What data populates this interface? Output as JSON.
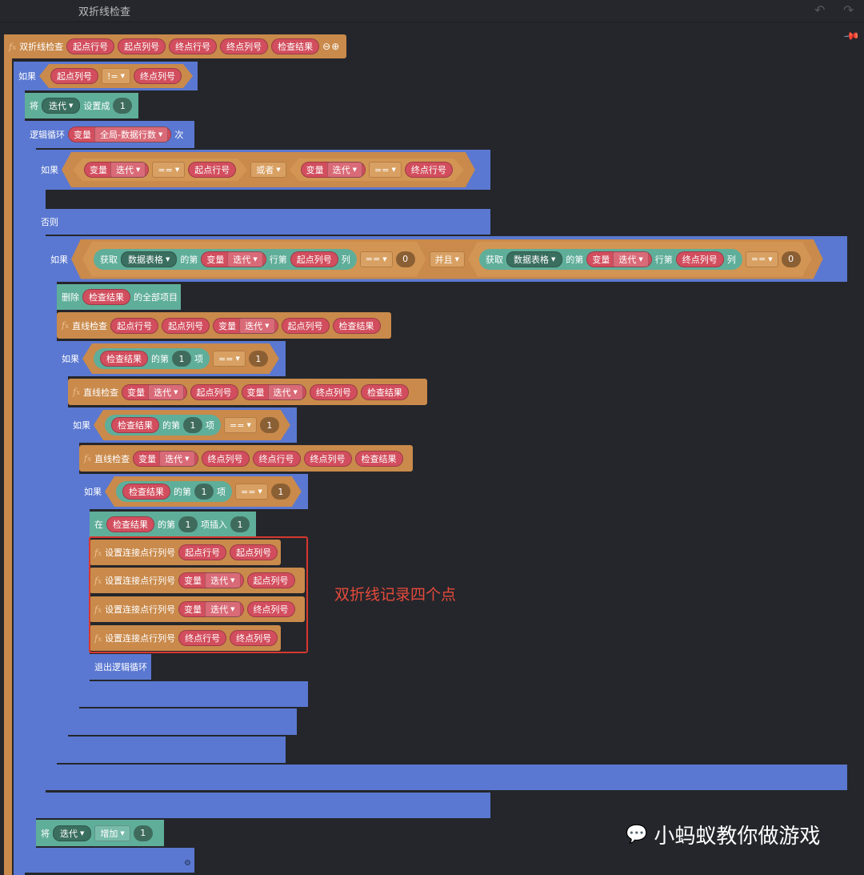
{
  "window": {
    "title": "双折线检查",
    "undo_icon": "undo-icon",
    "redo_icon": "redo-icon",
    "pin_icon": "pin-icon"
  },
  "func_def": {
    "fx": "f",
    "name": "双折线检查",
    "params": [
      "起点行号",
      "起点列号",
      "终点行号",
      "终点列号",
      "检查结果"
    ],
    "controls": "⊖⊕"
  },
  "blocks": {
    "if1": {
      "kw": "如果",
      "a": "起点列号",
      "op": "!=",
      "b": "终点列号"
    },
    "set1": {
      "kw": "将",
      "var": "迭代",
      "mid": "设置成",
      "val": "1"
    },
    "loop": {
      "kw": "逻辑循环",
      "var_kw": "变量",
      "var": "全局-数据行数",
      "tail": "次"
    },
    "if2": {
      "kw": "如果",
      "var_kw": "变量",
      "var": "迭代",
      "op": "==",
      "b": "起点行号",
      "or": "或者",
      "var_kw2": "变量",
      "var2": "迭代",
      "op2": "==",
      "b2": "终点行号"
    },
    "else": "否则",
    "if3": {
      "kw": "如果",
      "get": "获取",
      "table": "数据表格",
      "of": "的第",
      "var_kw": "变量",
      "var": "迭代",
      "row": "行第",
      "col": "起点列号",
      "col_tail": "列",
      "op": "==",
      "val": "0",
      "and": "并且",
      "get2": "获取",
      "table2": "数据表格",
      "of2": "的第",
      "var_kw2": "变量",
      "var2": "迭代",
      "row2": "行第",
      "col2": "终点列号",
      "col_tail2": "列",
      "op2": "==",
      "val2": "0"
    },
    "del": {
      "kw": "删除",
      "target": "检查结果",
      "tail": "的全部项目"
    },
    "call1": {
      "name": "直线检查",
      "args": [
        "起点行号",
        "起点列号"
      ],
      "var_kw": "变量",
      "var": "迭代",
      "args2": [
        "起点列号",
        "检查结果"
      ]
    },
    "if4": {
      "kw": "如果",
      "list": "检查结果",
      "of": "的第",
      "idx": "1",
      "item": "项",
      "op": "==",
      "val": "1"
    },
    "call2": {
      "name": "直线检查",
      "var_kw": "变量",
      "var": "迭代",
      "a1": "起点列号",
      "var_kw2": "变量",
      "var2": "迭代",
      "a2": "终点列号",
      "a3": "检查结果"
    },
    "if5": {
      "kw": "如果",
      "list": "检查结果",
      "of": "的第",
      "idx": "1",
      "item": "项",
      "op": "==",
      "val": "1"
    },
    "call3": {
      "name": "直线检查",
      "var_kw": "变量",
      "var": "迭代",
      "a1": "终点列号",
      "a2": "终点行号",
      "a3": "终点列号",
      "a4": "检查结果"
    },
    "if6": {
      "kw": "如果",
      "list": "检查结果",
      "of": "的第",
      "idx": "1",
      "item": "项",
      "op": "==",
      "val": "1"
    },
    "insert": {
      "kw": "在",
      "list": "检查结果",
      "of": "的第",
      "idx": "1",
      "tail": "项插入",
      "val": "1"
    },
    "set_pts": [
      {
        "name": "设置连接点行列号",
        "a": "起点行号",
        "b": "起点列号"
      },
      {
        "name": "设置连接点行列号",
        "var_kw": "变量",
        "var": "迭代",
        "b": "起点列号"
      },
      {
        "name": "设置连接点行列号",
        "var_kw": "变量",
        "var": "迭代",
        "b": "终点列号"
      },
      {
        "name": "设置连接点行列号",
        "a": "终点行号",
        "b": "终点列号"
      }
    ],
    "break": "退出逻辑循环",
    "inc": {
      "kw": "将",
      "var": "迭代",
      "op": "增加",
      "val": "1"
    }
  },
  "annotation": "双折线记录四个点",
  "watermark": "小蚂蚁教你做游戏"
}
